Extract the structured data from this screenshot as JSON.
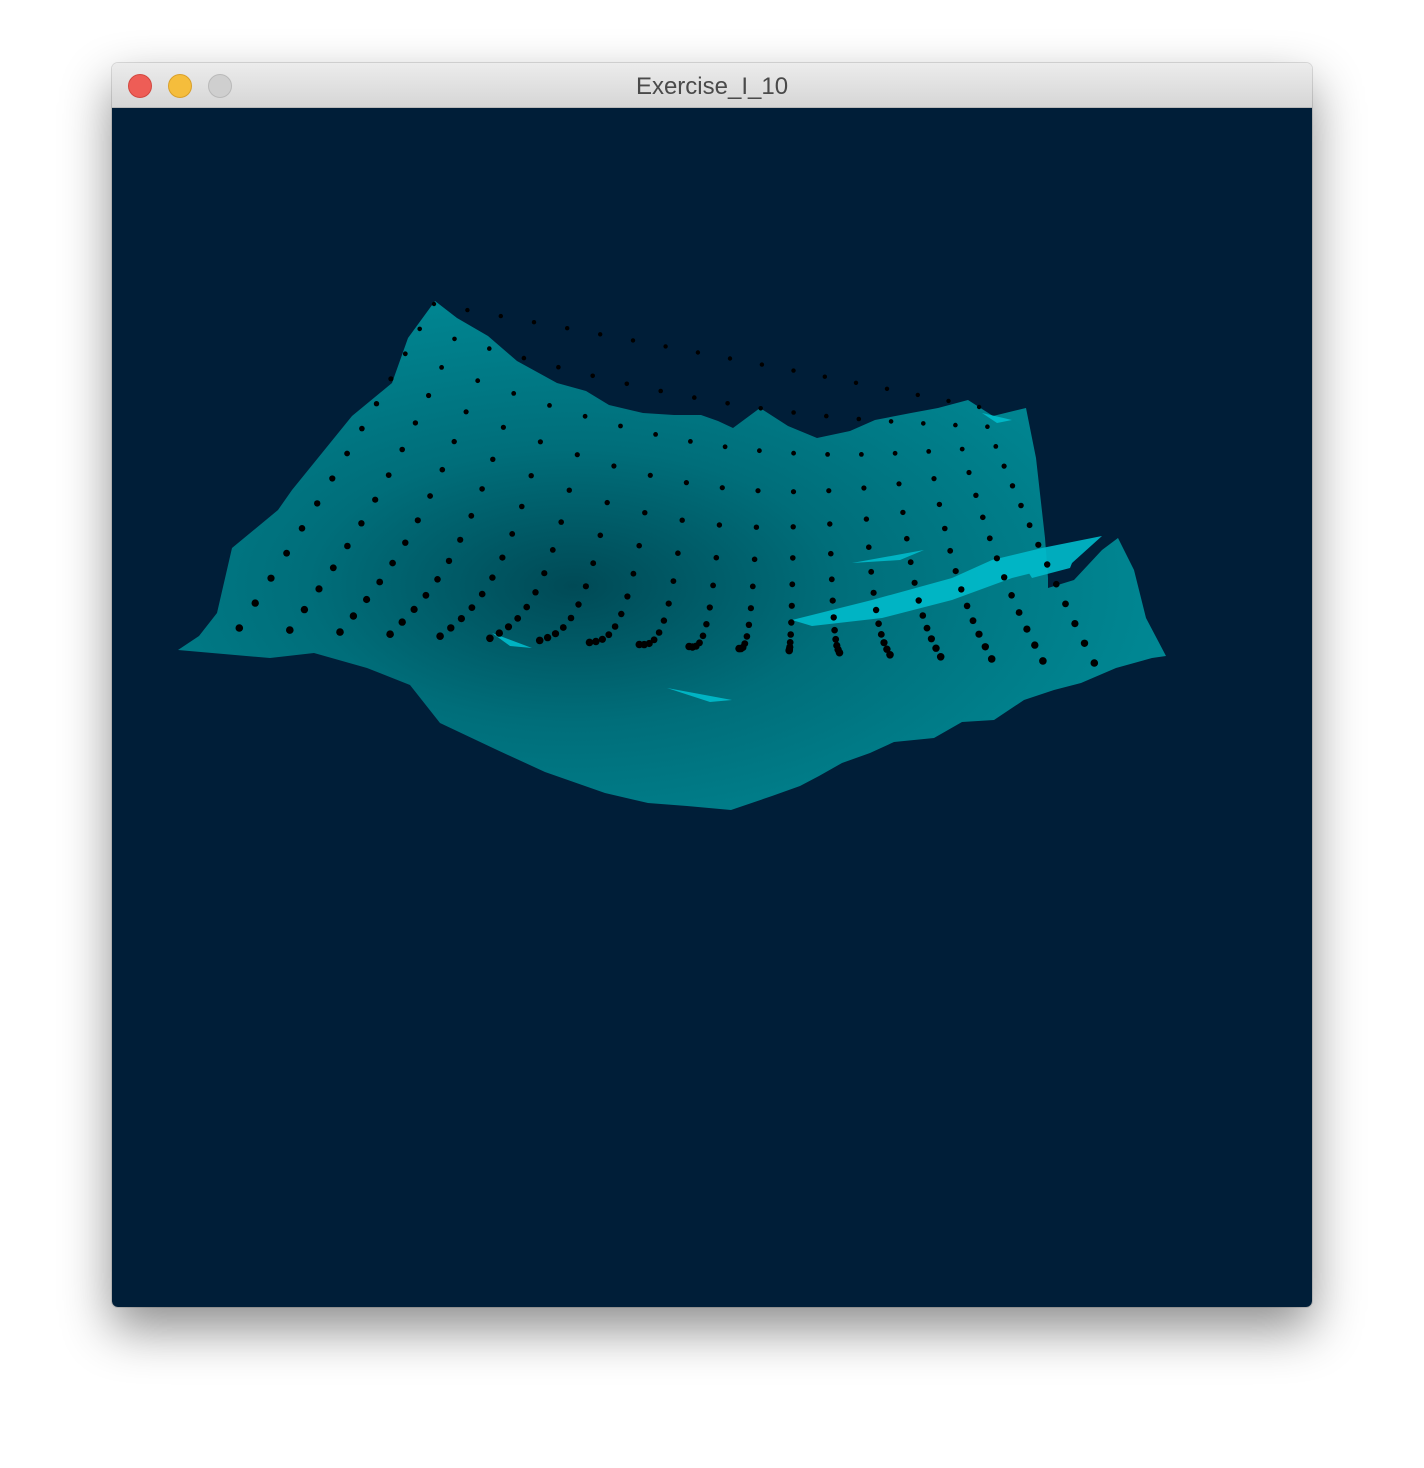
{
  "window": {
    "title": "Exercise_I_10"
  },
  "controls": {
    "close_icon": "close-icon",
    "minimize_icon": "minimize-icon",
    "zoom_icon": "zoom-icon"
  },
  "scene": {
    "background_color": "#001e38",
    "surface_color": "#00808c",
    "surface_highlight_color": "#00bccc",
    "point_color": "#000000"
  }
}
